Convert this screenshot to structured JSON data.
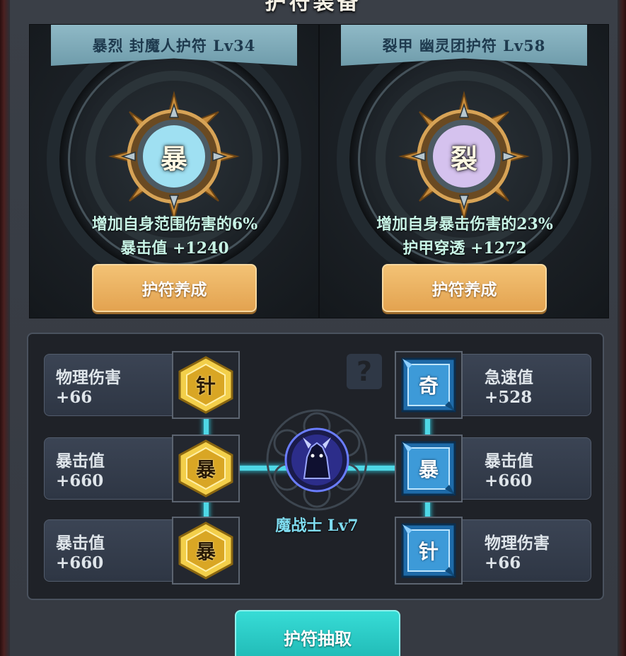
{
  "page": {
    "title": "护符装备"
  },
  "amulets": [
    {
      "name": "暴烈 封魔人护符 Lv34",
      "glyph": "暴",
      "effect": "增加自身范围伤害的6%",
      "stat": "暴击值 +1240",
      "button": "护符养成",
      "core_color": "#9fe0f2"
    },
    {
      "name": "裂甲 幽灵团护符 Lv58",
      "glyph": "裂",
      "effect": "增加自身暴击伤害的23%",
      "stat": "护甲穿透 +1272",
      "button": "护符养成",
      "core_color": "#d5c2ee"
    }
  ],
  "stats_left": [
    {
      "label": "物理伤害 +66",
      "glyph": "针"
    },
    {
      "label": "暴击值 +660",
      "glyph": "暴"
    },
    {
      "label": "暴击值 +660",
      "glyph": "暴"
    }
  ],
  "stats_right": [
    {
      "label": "急速值 +528",
      "glyph": "奇"
    },
    {
      "label": "暴击值 +660",
      "glyph": "暴"
    },
    {
      "label": "物理伤害 +66",
      "glyph": "针"
    }
  ],
  "center": {
    "label": "魔战士 Lv7",
    "icon": "warrior-portrait-icon"
  },
  "help": {
    "icon": "question-icon",
    "symbol": "?"
  },
  "draw_button": "护符抽取",
  "colors": {
    "gold_button": "#e9ae5c",
    "cyan_button": "#2ccac6",
    "link_line": "#4fd8e6"
  }
}
